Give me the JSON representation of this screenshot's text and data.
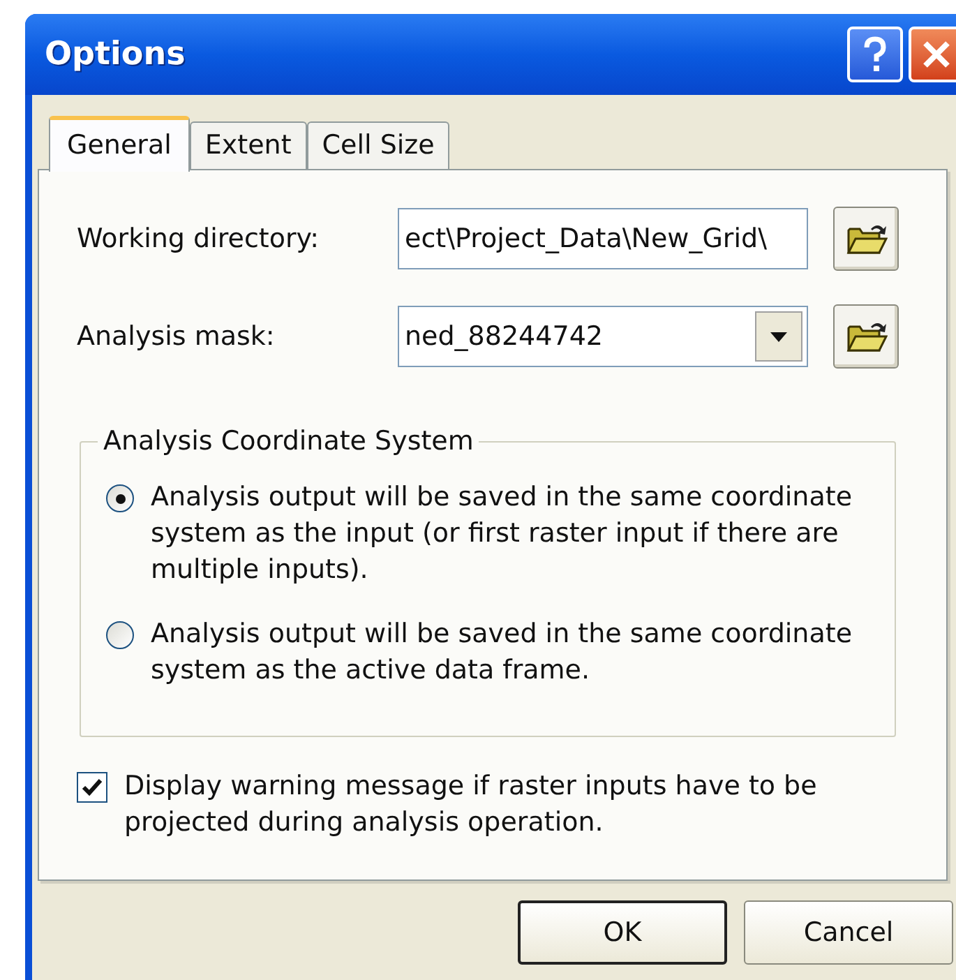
{
  "window": {
    "title": "Options"
  },
  "tabs": [
    {
      "label": "General",
      "selected": true
    },
    {
      "label": "Extent",
      "selected": false
    },
    {
      "label": "Cell Size",
      "selected": false
    }
  ],
  "working_directory": {
    "label": "Working directory:",
    "value": "ect\\Project_Data\\New_Grid\\"
  },
  "analysis_mask": {
    "label": "Analysis mask:",
    "value": "ned_88244742"
  },
  "coordinate_system": {
    "title": "Analysis Coordinate System",
    "options": [
      {
        "label": "Analysis output will be saved in the same coordinate system as the input (or first raster input if there are multiple inputs).",
        "selected": true
      },
      {
        "label": "Analysis output will be saved in the same coordinate system as the active data frame.",
        "selected": false
      }
    ]
  },
  "warning_checkbox": {
    "label": "Display warning message if raster inputs have to be projected during analysis operation.",
    "checked": true
  },
  "buttons": [
    {
      "label": "OK",
      "default": true
    },
    {
      "label": "Cancel",
      "default": false
    }
  ]
}
